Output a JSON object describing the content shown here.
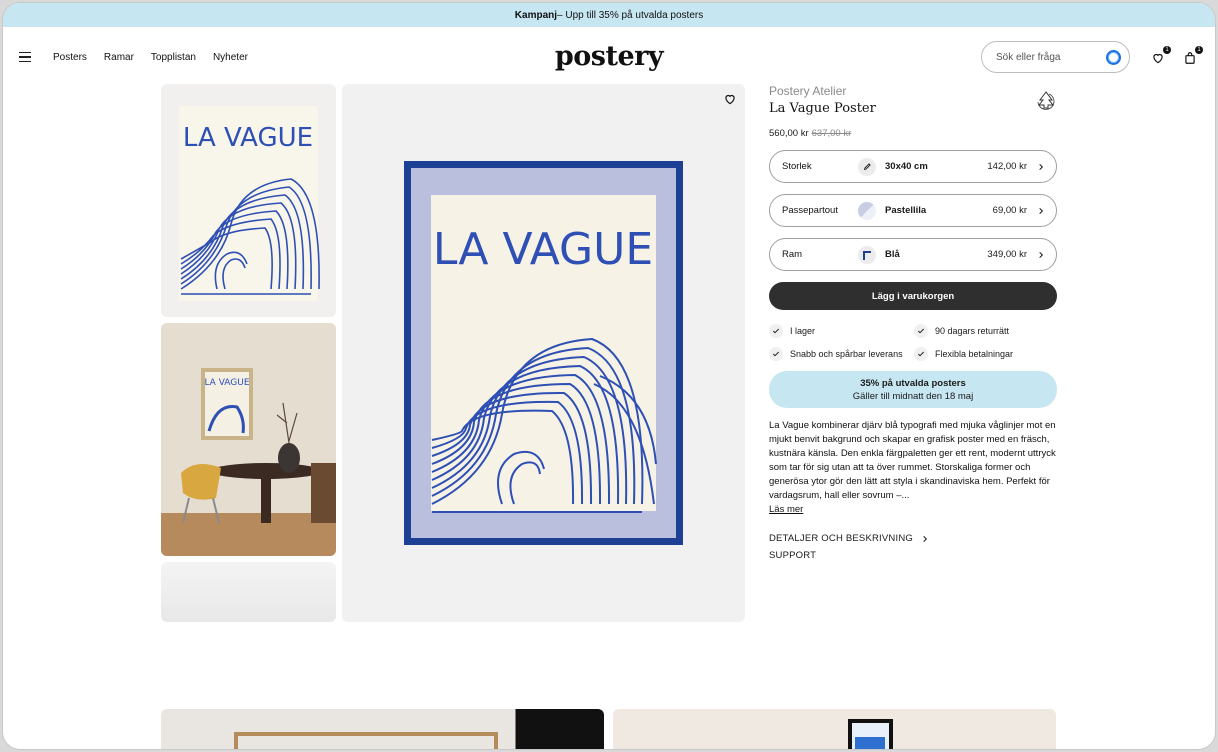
{
  "promo": {
    "bold": "Kampanj",
    "text": " – Upp till 35% på utvalda posters"
  },
  "header": {
    "nav": [
      "Posters",
      "Ramar",
      "Topplistan",
      "Nyheter"
    ],
    "logo": "postery",
    "search_placeholder": "Sök eller fråga",
    "wishlist_count": "1",
    "cart_count": "1"
  },
  "poster": {
    "art_title": "LA VAGUE"
  },
  "product": {
    "brand": "Postery Atelier",
    "title": "La Vague Poster",
    "price": "560,00 kr",
    "old_price": "637,00 kr",
    "options": [
      {
        "label": "Storlek",
        "value": "30x40 cm",
        "price": "142,00 kr"
      },
      {
        "label": "Passepartout",
        "value": "Pastellila",
        "price": "69,00 kr"
      },
      {
        "label": "Ram",
        "value": "Blå",
        "price": "349,00 kr"
      }
    ],
    "cart_label": "Lägg i varukorgen",
    "usps": [
      "I lager",
      "90 dagars returrätt",
      "Snabb och spårbar leverans",
      "Flexibla betalningar"
    ],
    "deal_title": "35% på utvalda posters",
    "deal_sub": "Gäller till midnatt den 18 maj",
    "description": "La Vague kombinerar djärv blå typografi med mjuka våglinjer mot en mjukt benvit bakgrund och skapar en grafisk poster med en fräsch, kustnära känsla. Den enkla färgpaletten ger ett rent, modernt uttryck som tar för sig utan att ta över rummet. Storskaliga former och generösa ytor gör den lätt att styla i skandinaviska hem. Perfekt för vardagsrum, hall eller sovrum –...",
    "read_more": "Läs mer",
    "details_label": "DETALJER OCH BESKRIVNING",
    "support_label": "SUPPORT"
  },
  "colors": {
    "accent_blue": "#2e4fb4",
    "promo_bg": "#c6e6f1",
    "frame_blue": "#1d3f94",
    "mat_lilac": "#b9bfdc"
  }
}
